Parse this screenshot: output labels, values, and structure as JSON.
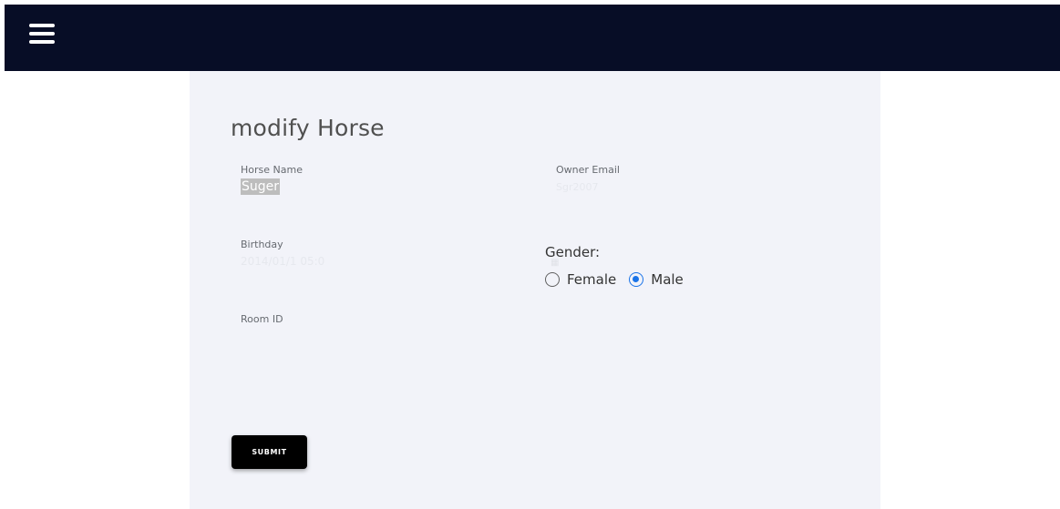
{
  "header": {
    "menu_icon": "hamburger-menu-icon",
    "background": "#070d26"
  },
  "form": {
    "title": "modify Horse",
    "horse_name": {
      "label": "Horse Name",
      "value": "Suger"
    },
    "owner_email": {
      "label": "Owner Email",
      "value": "Sgr2007"
    },
    "birthday": {
      "label": "Birthday",
      "value": "2014/01/1 05:0",
      "calendar_icon": "calendar-icon"
    },
    "room_id": {
      "label": "Room ID"
    },
    "gender": {
      "label": "Gender:",
      "options": [
        "Female",
        "Male"
      ],
      "selected": "Male"
    },
    "submit_label": "SUBMIT",
    "accent_color": "#1a73e8"
  }
}
